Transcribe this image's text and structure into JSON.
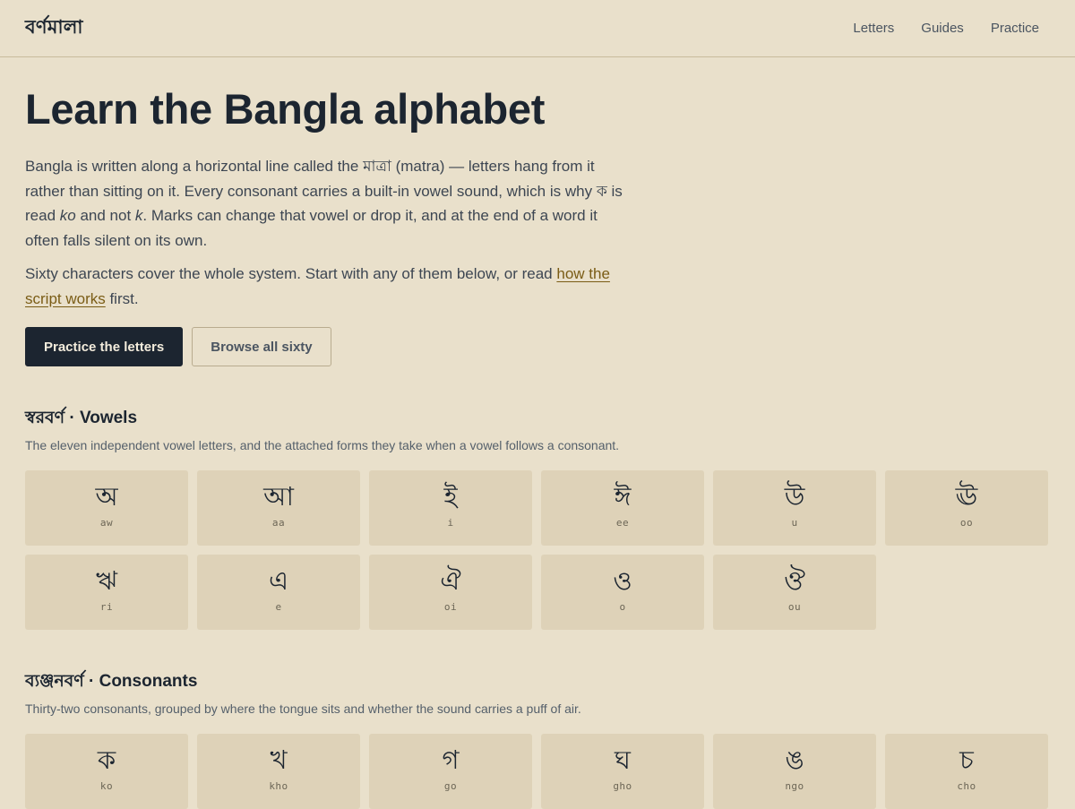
{
  "header": {
    "brand": "বর্ণমালা",
    "nav": [
      "Letters",
      "Guides",
      "Practice"
    ]
  },
  "hero": {
    "title": "Learn the Bangla alphabet",
    "p1_a": "Bangla is written along a horizontal line called the ",
    "p1_matra": "মাত্রা",
    "p1_b": " (matra) — letters hang from it rather than sitting on it. Every consonant carries a built-in vowel sound, which is why ",
    "p1_ka": "ক",
    "p1_c": " is read ",
    "p1_ko": "ko",
    "p1_d": " and not ",
    "p1_k": "k",
    "p1_e": ". Marks can change that vowel or drop it, and at the end of a word it often falls silent on its own.",
    "p2_a": "Sixty characters cover the whole system. Start with any of them below, or read ",
    "p2_link": "how the script works",
    "p2_b": " first.",
    "primary_button": "Practice the letters",
    "secondary_button": "Browse all sixty"
  },
  "vowels": {
    "title": "স্বরবর্ণ · Vowels",
    "description": "The eleven independent vowel letters, and the attached forms they take when a vowel follows a consonant.",
    "letters": [
      {
        "glyph": "অ",
        "roman": "aw"
      },
      {
        "glyph": "আ",
        "roman": "aa"
      },
      {
        "glyph": "ই",
        "roman": "i"
      },
      {
        "glyph": "ঈ",
        "roman": "ee"
      },
      {
        "glyph": "উ",
        "roman": "u"
      },
      {
        "glyph": "ঊ",
        "roman": "oo"
      },
      {
        "glyph": "ঋ",
        "roman": "ri"
      },
      {
        "glyph": "এ",
        "roman": "e"
      },
      {
        "glyph": "ঐ",
        "roman": "oi"
      },
      {
        "glyph": "ও",
        "roman": "o"
      },
      {
        "glyph": "ঔ",
        "roman": "ou"
      }
    ]
  },
  "consonants": {
    "title": "ব্যঞ্জনবর্ণ · Consonants",
    "description": "Thirty-two consonants, grouped by where the tongue sits and whether the sound carries a puff of air.",
    "letters": [
      {
        "glyph": "ক",
        "roman": "ko"
      },
      {
        "glyph": "খ",
        "roman": "kho"
      },
      {
        "glyph": "গ",
        "roman": "go"
      },
      {
        "glyph": "ঘ",
        "roman": "gho"
      },
      {
        "glyph": "ঙ",
        "roman": "ngo"
      },
      {
        "glyph": "চ",
        "roman": "cho"
      }
    ]
  }
}
